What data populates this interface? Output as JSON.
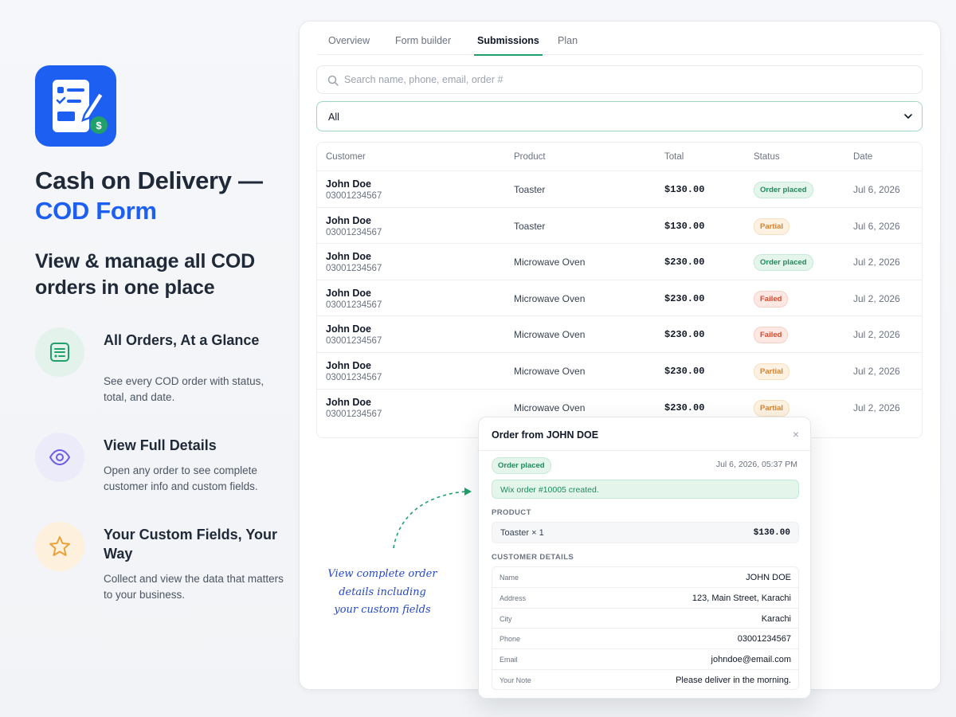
{
  "hero": {
    "title": "Cash on Delivery —",
    "accent": "COD Form",
    "subhead": "View & manage all COD orders in one place"
  },
  "features": [
    {
      "title": "All Orders, At a Glance",
      "desc": "See every COD order with status, total, and date.",
      "icon": "list-icon"
    },
    {
      "title": "View Full Details",
      "desc": "Open any order to see complete customer info and custom fields.",
      "icon": "eye-icon"
    },
    {
      "title": "Your Custom Fields, Your Way",
      "desc": "Collect and view the data that matters to your business.",
      "icon": "star-icon"
    }
  ],
  "tabs": [
    {
      "label": "Overview",
      "active": false
    },
    {
      "label": "Form builder",
      "active": false
    },
    {
      "label": "Submissions",
      "active": true
    },
    {
      "label": "Plan",
      "active": false
    }
  ],
  "search": {
    "placeholder": "Search name, phone, email, order #",
    "value": ""
  },
  "filter": {
    "selected": "All"
  },
  "table": {
    "columns": [
      "Customer",
      "Product",
      "Total",
      "Status",
      "Date"
    ],
    "rows": [
      {
        "name": "John Doe",
        "phone": "03001234567",
        "product": "Toaster",
        "total": "$130.00",
        "status": "Order placed",
        "date": "Jul 6, 2026"
      },
      {
        "name": "John Doe",
        "phone": "03001234567",
        "product": "Toaster",
        "total": "$130.00",
        "status": "Partial",
        "date": "Jul 6, 2026"
      },
      {
        "name": "John Doe",
        "phone": "03001234567",
        "product": "Microwave Oven",
        "total": "$230.00",
        "status": "Order placed",
        "date": "Jul 2, 2026"
      },
      {
        "name": "John Doe",
        "phone": "03001234567",
        "product": "Microwave Oven",
        "total": "$230.00",
        "status": "Failed",
        "date": "Jul 2, 2026"
      },
      {
        "name": "John Doe",
        "phone": "03001234567",
        "product": "Microwave Oven",
        "total": "$230.00",
        "status": "Failed",
        "date": "Jul 2, 2026"
      },
      {
        "name": "John Doe",
        "phone": "03001234567",
        "product": "Microwave Oven",
        "total": "$230.00",
        "status": "Partial",
        "date": "Jul 2, 2026"
      },
      {
        "name": "John Doe",
        "phone": "03001234567",
        "product": "Microwave Oven",
        "total": "$230.00",
        "status": "Partial",
        "date": "Jul 2, 2026"
      }
    ]
  },
  "modal": {
    "title": "Order from JOHN DOE",
    "close": "×",
    "status": "Order placed",
    "timestamp": "Jul 6, 2026, 05:37 PM",
    "notice": "Wix order #10005 created.",
    "product_section": "PRODUCT",
    "product_name": "Toaster × 1",
    "product_price": "$130.00",
    "customer_section": "CUSTOMER DETAILS",
    "details": [
      {
        "key": "Name",
        "value": "JOHN DOE"
      },
      {
        "key": "Address",
        "value": "123, Main Street, Karachi"
      },
      {
        "key": "City",
        "value": "Karachi"
      },
      {
        "key": "Phone",
        "value": "03001234567"
      },
      {
        "key": "Email",
        "value": "johndoe@email.com"
      },
      {
        "key": "Your Note",
        "value": "Please deliver in the morning."
      }
    ]
  },
  "annotation": [
    "View complete order",
    "details including",
    "your custom fields"
  ],
  "colors": {
    "brand": "#1d5ff0",
    "accent_green": "#22a06b",
    "placed": "#1f8a5b",
    "partial": "#d9822b",
    "failed": "#d9482b"
  }
}
